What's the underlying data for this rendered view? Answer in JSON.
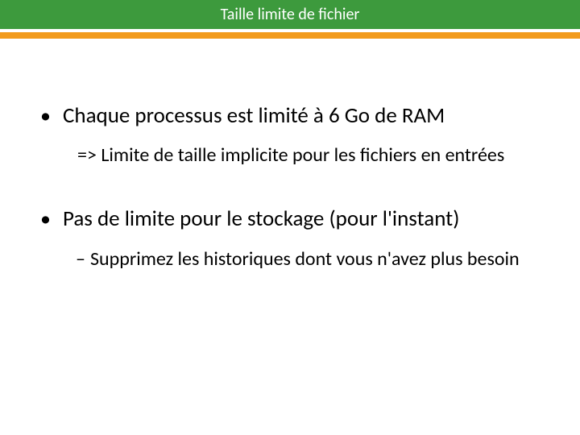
{
  "title": "Taille limite de fichier",
  "bullets": [
    {
      "text": "Chaque processus est limité à 6 Go de RAM",
      "sub": "=> Limite de taille implicite pour les fichiers en entrées",
      "sub_style": "arrow"
    },
    {
      "text": "Pas de limite pour le stockage (pour l'instant)",
      "sub": "Supprimez les historiques dont vous n'avez plus besoin",
      "sub_style": "dash"
    }
  ]
}
